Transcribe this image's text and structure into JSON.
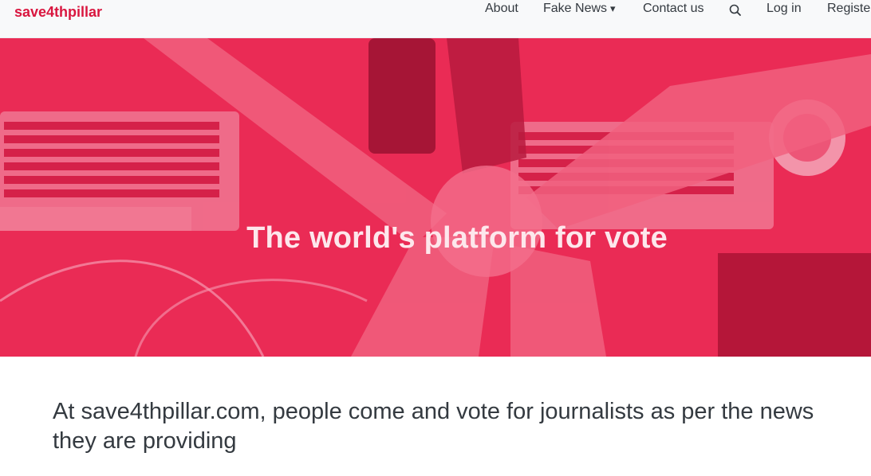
{
  "brand": "save4thpillar",
  "nav": {
    "about": "About",
    "fake_news": "Fake News",
    "fake_news_caret": "▾",
    "contact": "Contact us",
    "search_icon": "search-icon",
    "login": "Log in",
    "register": "Register"
  },
  "hero": {
    "title": "The world's platform for vote"
  },
  "tagline": "At save4thpillar.com, people come and vote for journalists as per the news they are providing",
  "colors": {
    "brand": "#d9163f",
    "hero_overlay": "#e8264f",
    "text": "#343a40",
    "navbar_bg": "#f8f9fa"
  }
}
